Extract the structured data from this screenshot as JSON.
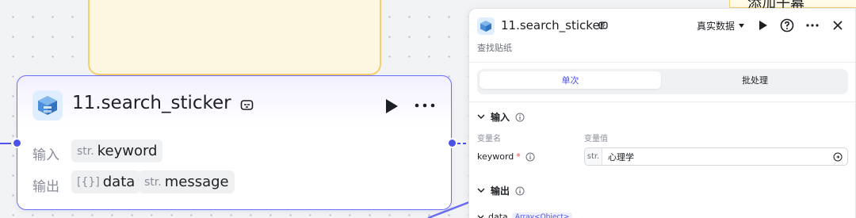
{
  "canvas": {
    "top_node_color": "#f5cf6b",
    "peek_node": {
      "text": "添加子幕"
    }
  },
  "node": {
    "title": "11.search_sticker",
    "icon": "package-box-icon",
    "badge_icon": "plugin-badge-icon",
    "accent": "#4d53e8",
    "input_label": "输入",
    "output_label": "输出",
    "inputs": [
      {
        "type": "str.",
        "name": "keyword"
      }
    ],
    "outputs": [
      {
        "type": "[{}]",
        "name": "data"
      },
      {
        "type": "str.",
        "name": "message"
      }
    ]
  },
  "panel": {
    "title": "11.search_sticker",
    "subtitle": "查找贴纸",
    "data_mode": "真实数据",
    "tabs": [
      {
        "label": "单次",
        "active": true
      },
      {
        "label": "批处理",
        "active": false
      }
    ],
    "input_section": {
      "title": "输入",
      "col_name": "变量名",
      "col_value": "变量值",
      "var_name": "keyword",
      "required_mark": "*",
      "value_type": "str.",
      "value": "心理学"
    },
    "output_section": {
      "title": "输出",
      "first_field": "data",
      "first_field_type": "Array<Object>"
    }
  }
}
